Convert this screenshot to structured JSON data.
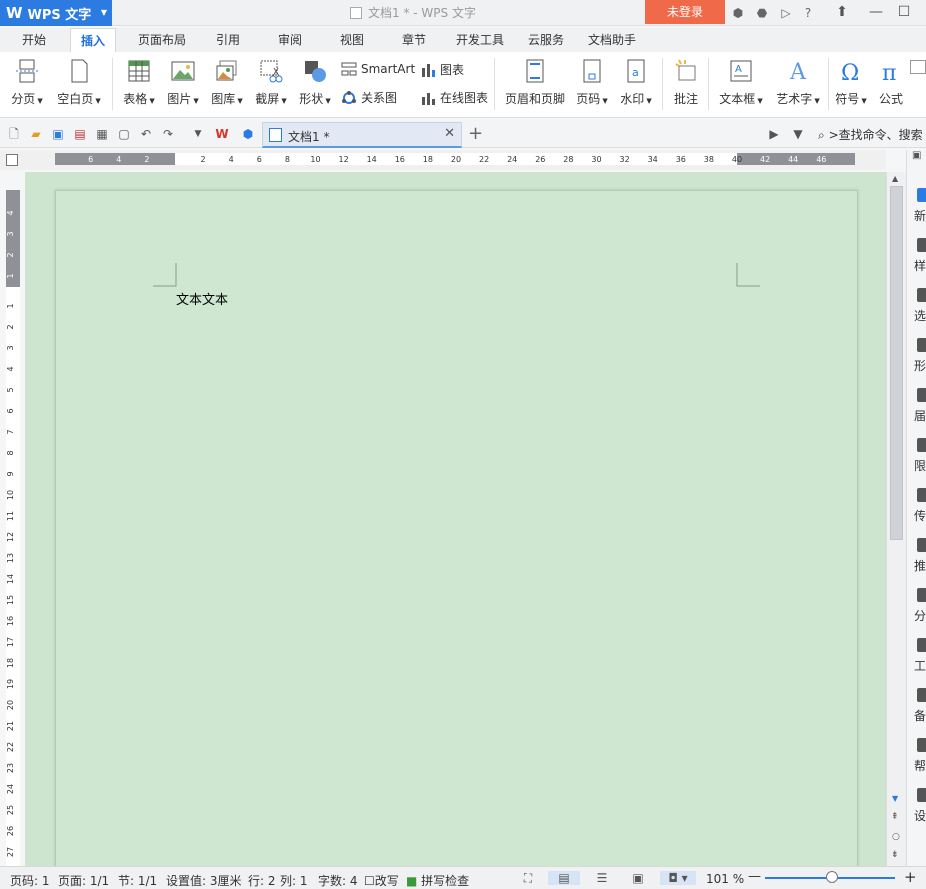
{
  "titlebar": {
    "app_menu": "WPS 文字",
    "document_title": "文档1 * - WPS 文字",
    "login_button": "未登录",
    "help_label": "?"
  },
  "tabs": [
    "开始",
    "插入",
    "页面布局",
    "引用",
    "审阅",
    "视图",
    "章节",
    "开发工具",
    "云服务",
    "文档助手"
  ],
  "active_tab": "插入",
  "ribbon": {
    "page_break": "分页",
    "blank_page": "空白页",
    "table": "表格",
    "picture": "图片",
    "gallery": "图库",
    "screenshot": "截屏",
    "shapes": "形状",
    "smartart": "SmartArt",
    "chart": "图表",
    "relation": "关系图",
    "online_chart": "在线图表",
    "header_footer": "页眉和页脚",
    "page_number": "页码",
    "watermark": "水印",
    "comment": "批注",
    "textbox": "文本框",
    "wordart": "艺术字",
    "symbol": "符号",
    "formula": "公式"
  },
  "doc_tab": {
    "label": "文档1 *"
  },
  "search_command": ">查找命令、搜索",
  "ruler": {
    "h_ticks_left": [
      "6",
      "4",
      "2"
    ],
    "h_ticks_right": [
      "2",
      "4",
      "6",
      "8",
      "10",
      "12",
      "14",
      "16",
      "18",
      "20",
      "22",
      "24",
      "26",
      "28",
      "30",
      "32",
      "34",
      "36",
      "38",
      "40",
      "42",
      "44",
      "46"
    ],
    "v_ticks_top": [
      "4",
      "3",
      "2",
      "1"
    ],
    "v_ticks_bottom": [
      "1",
      "2",
      "3",
      "4",
      "5",
      "6",
      "7",
      "8",
      "9",
      "10",
      "11",
      "12",
      "13",
      "14",
      "15",
      "16",
      "17",
      "18",
      "19",
      "20",
      "21",
      "22",
      "23",
      "24",
      "25",
      "26",
      "27"
    ]
  },
  "document": {
    "body_text": "文本文本"
  },
  "taskpane": [
    "新",
    "样",
    "选",
    "形",
    "届",
    "限",
    "传",
    "推",
    "分",
    "工",
    "备",
    "帮",
    "设"
  ],
  "statusbar": {
    "page": "页码: 1",
    "pages": "页面: 1/1",
    "section": "节: 1/1",
    "setting": "设置值: 3厘米",
    "row": "行: 2",
    "col": "列: 1",
    "words": "字数: 4",
    "revise": "改写",
    "spellcheck": "拼写检查",
    "zoom": "101 %",
    "zoom_fraction": 0.52
  },
  "colors": {
    "accent": "#2b7be0",
    "login": "#f06a4a",
    "canvas": "#cde4cf",
    "page": "#cfe6d0"
  }
}
